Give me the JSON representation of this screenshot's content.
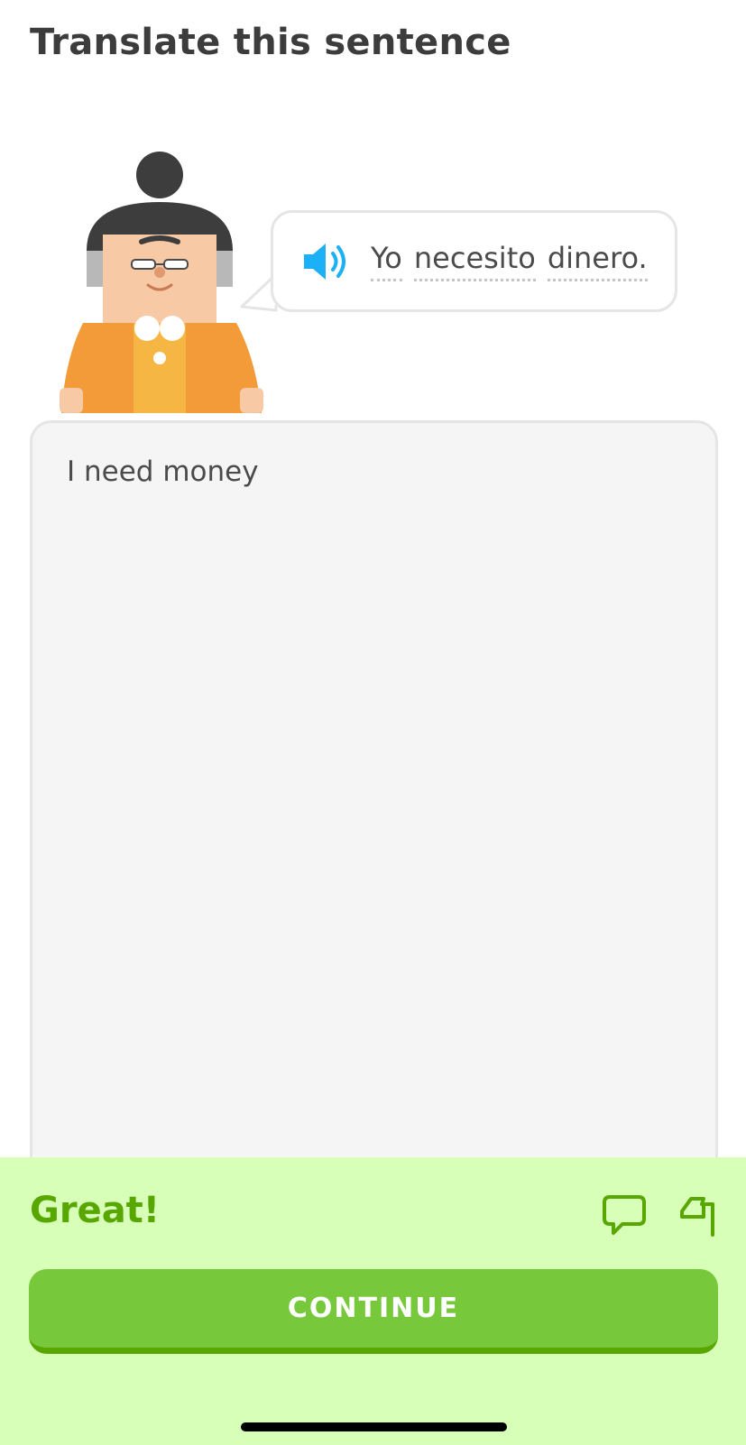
{
  "header": {
    "title": "Translate this sentence"
  },
  "prompt": {
    "words": [
      "Yo",
      "necesito",
      "dinero."
    ]
  },
  "answer": {
    "value": "I need money"
  },
  "feedback": {
    "title": "Great!",
    "continue_label": "CONTINUE"
  },
  "colors": {
    "accent_green": "#77c93b",
    "feedback_bg": "#d7ffb8",
    "feedback_text": "#58a700",
    "speaker_blue": "#1cb0f6"
  }
}
